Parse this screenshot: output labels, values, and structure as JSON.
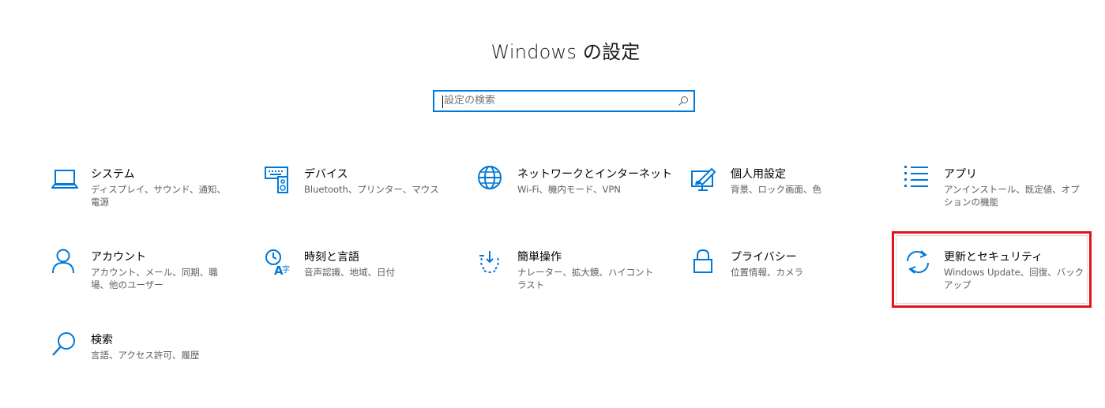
{
  "window": {
    "title": "Windows の設定"
  },
  "search": {
    "placeholder": "設定の検索"
  },
  "accent_color": "#0078d7",
  "highlight_color": "#e2141c",
  "tiles": [
    {
      "title": "システム",
      "description": "ディスプレイ、サウンド、通知、電源",
      "icon": "laptop-icon"
    },
    {
      "title": "デバイス",
      "description": "Bluetooth、プリンター、マウス",
      "icon": "keyboard-speaker-icon"
    },
    {
      "title": "ネットワークとインターネット",
      "description": "Wi-Fi、機内モード、VPN",
      "icon": "globe-icon"
    },
    {
      "title": "個人用設定",
      "description": "背景、ロック画面、色",
      "icon": "paint-monitor-icon"
    },
    {
      "title": "アプリ",
      "description": "アンインストール、既定値、オプションの機能",
      "icon": "app-list-icon"
    },
    {
      "title": "アカウント",
      "description": "アカウント、メール、同期、職場、他のユーザー",
      "icon": "person-icon"
    },
    {
      "title": "時刻と言語",
      "description": "音声認識、地域、日付",
      "icon": "time-language-icon"
    },
    {
      "title": "簡単操作",
      "description": "ナレーター、拡大鏡、ハイコントラスト",
      "icon": "ease-of-access-icon"
    },
    {
      "title": "プライバシー",
      "description": "位置情報、カメラ",
      "icon": "lock-icon"
    },
    {
      "title": "更新とセキュリティ",
      "description": "Windows Update、回復、バックアップ",
      "icon": "update-sync-icon",
      "highlighted": true
    },
    {
      "title": "検索",
      "description": "言語、アクセス許可、履歴",
      "icon": "search-icon"
    }
  ]
}
